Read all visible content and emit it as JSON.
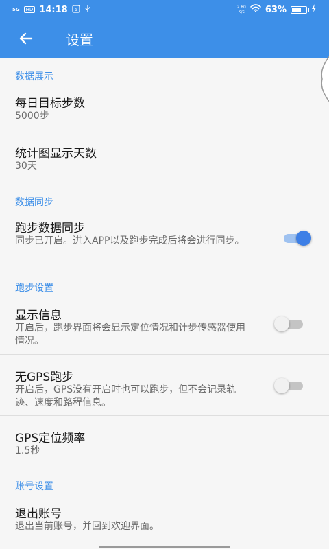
{
  "status_bar": {
    "network": "5G",
    "network2": "HD",
    "time": "14:18",
    "speed_value": "2.80",
    "speed_unit": "K/s",
    "battery_percent": "63%",
    "battery_level": 0.63
  },
  "app_bar": {
    "title": "设置",
    "back_icon": "arrow-left-icon"
  },
  "sections": {
    "display": {
      "header": "数据展示",
      "daily_goal": {
        "title": "每日目标步数",
        "value": "5000步"
      },
      "chart_days": {
        "title": "统计图显示天数",
        "value": "30天"
      }
    },
    "sync": {
      "header": "数据同步",
      "run_sync": {
        "title": "跑步数据同步",
        "description": "同步已开启。进入APP以及跑步完成后将会进行同步。",
        "enabled": true
      }
    },
    "run": {
      "header": "跑步设置",
      "show_info": {
        "title": "显示信息",
        "description": "开启后，跑步界面将会显示定位情况和计步传感器使用情况。",
        "enabled": false
      },
      "no_gps": {
        "title": "无GPS跑步",
        "description": "开启后，GPS没有开启时也可以跑步，但不会记录轨迹、速度和路程信息。",
        "enabled": false
      },
      "gps_freq": {
        "title": "GPS定位频率",
        "value": "1.5秒"
      }
    },
    "account": {
      "header": "账号设置",
      "logout": {
        "title": "退出账号",
        "description": "退出当前账号，并回到欢迎界面。"
      }
    }
  },
  "colors": {
    "primary": "#3d8fe8",
    "switch_on": "#3d7fe6",
    "background": "#f6f6f6"
  }
}
